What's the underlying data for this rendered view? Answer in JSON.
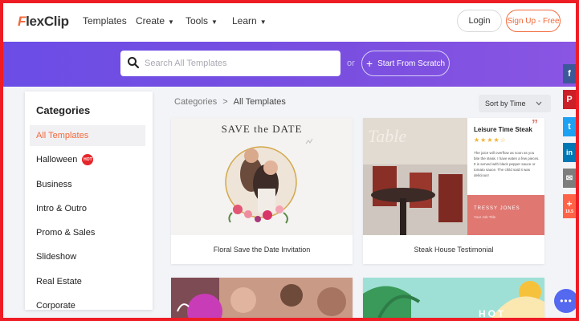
{
  "header": {
    "logo": {
      "f": "F",
      "rest": "lexClip"
    },
    "nav": [
      {
        "label": "Templates",
        "has_dropdown": false
      },
      {
        "label": "Create",
        "has_dropdown": true
      },
      {
        "label": "Tools",
        "has_dropdown": true
      },
      {
        "label": "Learn",
        "has_dropdown": true
      }
    ],
    "login_label": "Login",
    "signup_label": "Sign Up - Free"
  },
  "search": {
    "placeholder": "Search All Templates",
    "value": "",
    "or_label": "or",
    "scratch_label": "Start From Scratch",
    "scratch_icon": "plus-icon"
  },
  "sidebar": {
    "title": "Categories",
    "items": [
      {
        "label": "All Templates",
        "active": true
      },
      {
        "label": "Halloween",
        "badge": "HOT"
      },
      {
        "label": "Business"
      },
      {
        "label": "Intro & Outro"
      },
      {
        "label": "Promo & Sales"
      },
      {
        "label": "Slideshow"
      },
      {
        "label": "Real Estate"
      },
      {
        "label": "Corporate"
      }
    ]
  },
  "breadcrumb": {
    "root": "Categories",
    "sep": ">",
    "current": "All Templates"
  },
  "sort": {
    "label": "Sort by Time"
  },
  "cards": [
    {
      "title": "Floral Save the Date Invitation",
      "thumb_text": "SAVE the DATE"
    },
    {
      "title": "Steak House Testimonial",
      "thumb_heading": "Leisure Time Steak",
      "thumb_stars": "★★★★☆",
      "thumb_body": "The juice will overflow as soon as you bite the steak. I have eaten a few pieces. It is served with black pepper sauce or tomato sauce. The child said it was delicious!",
      "thumb_name": "TRESSY JONES",
      "thumb_role": "Your Job Title",
      "thumb_sign": "Table"
    },
    {
      "title": ""
    },
    {
      "title": "",
      "thumb_text": "HOT"
    }
  ],
  "share": [
    {
      "icon": "facebook-icon",
      "glyph": "f",
      "color": "#3b5998"
    },
    {
      "icon": "pinterest-icon",
      "glyph": "P",
      "color": "#cb2027"
    },
    {
      "icon": "twitter-icon",
      "glyph": "t",
      "color": "#1da1f2"
    },
    {
      "icon": "linkedin-icon",
      "glyph": "in",
      "color": "#0077b5"
    },
    {
      "icon": "email-icon",
      "glyph": "✉",
      "color": "#7d7d7d"
    },
    {
      "icon": "share-plus-icon",
      "glyph": "+",
      "color": "#ff6347",
      "count": "10.5"
    }
  ],
  "colors": {
    "accent": "#f2683a",
    "band": "#6b4de6",
    "chat": "#5468f0"
  }
}
